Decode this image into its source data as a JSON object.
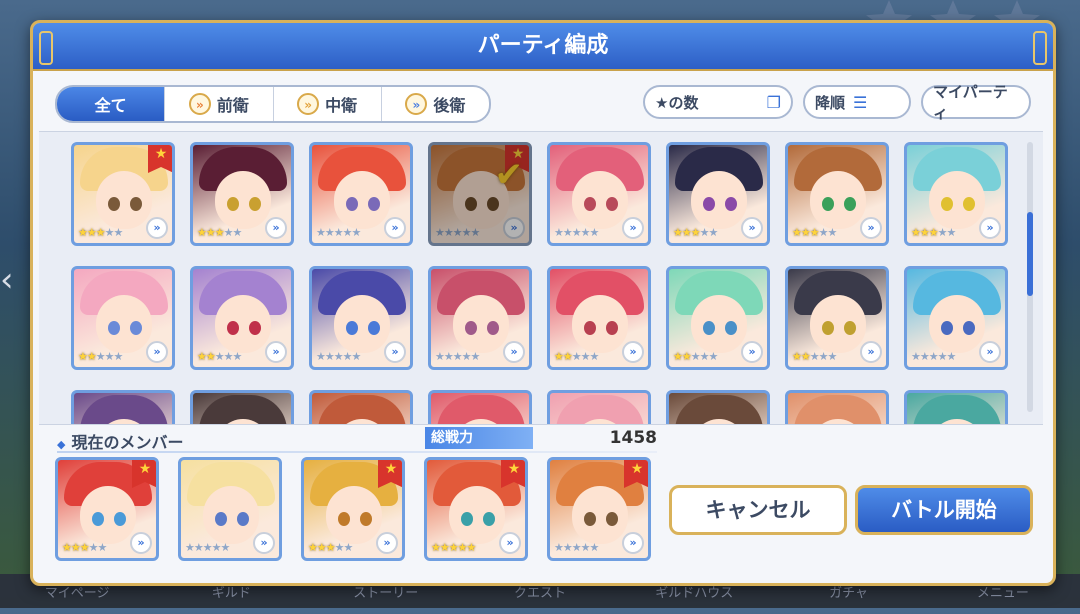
{
  "title": "パーティ編成",
  "filter_tabs": [
    {
      "label": "全て",
      "active": true,
      "icon": ""
    },
    {
      "label": "前衛",
      "active": false,
      "icon": "front-role-icon"
    },
    {
      "label": "中衛",
      "active": false,
      "icon": "middle-role-icon"
    },
    {
      "label": "後衛",
      "active": false,
      "icon": "back-role-icon"
    }
  ],
  "star_filter_label": "★の数",
  "sort_label": "降順",
  "my_party_label": "マイパーティ",
  "roster": [
    {
      "stars": 3,
      "fav": true,
      "selected": false,
      "hair": "#f6d48c",
      "eye": "#7a5a3a"
    },
    {
      "stars": 3,
      "fav": false,
      "selected": false,
      "hair": "#5a1e34",
      "eye": "#c9a030"
    },
    {
      "stars": 0,
      "fav": false,
      "selected": false,
      "hair": "#e8523c",
      "eye": "#7a6ab8"
    },
    {
      "stars": 0,
      "fav": true,
      "selected": true,
      "hair": "#c8763a",
      "eye": "#6a4a2a"
    },
    {
      "stars": 0,
      "fav": false,
      "selected": false,
      "hair": "#e3607a",
      "eye": "#b84a5a"
    },
    {
      "stars": 3,
      "fav": false,
      "selected": false,
      "hair": "#2a2a48",
      "eye": "#8a4aa8"
    },
    {
      "stars": 3,
      "fav": false,
      "selected": false,
      "hair": "#b26a3a",
      "eye": "#3aa05a"
    },
    {
      "stars": 3,
      "fav": false,
      "selected": false,
      "hair": "#7ad0d8",
      "eye": "#e0c030"
    },
    {
      "stars": 2,
      "fav": false,
      "selected": false,
      "hair": "#f4a8c0",
      "eye": "#6a8ad8"
    },
    {
      "stars": 2,
      "fav": false,
      "selected": false,
      "hair": "#a482d0",
      "eye": "#c0304a"
    },
    {
      "stars": 0,
      "fav": false,
      "selected": false,
      "hair": "#4a4aa8",
      "eye": "#4a7ad8"
    },
    {
      "stars": 0,
      "fav": false,
      "selected": false,
      "hair": "#c8506a",
      "eye": "#a05a8a"
    },
    {
      "stars": 2,
      "fav": false,
      "selected": false,
      "hair": "#e25066",
      "eye": "#b84050"
    },
    {
      "stars": 2,
      "fav": false,
      "selected": false,
      "hair": "#7ed8b8",
      "eye": "#4a90c8"
    },
    {
      "stars": 2,
      "fav": false,
      "selected": false,
      "hair": "#3a3a4a",
      "eye": "#c0a030"
    },
    {
      "stars": 0,
      "fav": false,
      "selected": false,
      "hair": "#56b8e0",
      "eye": "#4a6ac0"
    },
    {
      "stars": 0,
      "fav": false,
      "selected": false,
      "hair": "#6a4a8a",
      "eye": "#6a4a8a"
    },
    {
      "stars": 0,
      "fav": false,
      "selected": false,
      "hair": "#4a3a3a",
      "eye": "#4a3a3a"
    },
    {
      "stars": 0,
      "fav": false,
      "selected": false,
      "hair": "#c05a3a",
      "eye": "#c05a3a"
    },
    {
      "stars": 0,
      "fav": false,
      "selected": false,
      "hair": "#e05a6a",
      "eye": "#e05a6a"
    },
    {
      "stars": 0,
      "fav": false,
      "selected": false,
      "hair": "#f0a0b0",
      "eye": "#f0a0b0"
    },
    {
      "stars": 0,
      "fav": false,
      "selected": false,
      "hair": "#6a4a3a",
      "eye": "#6a4a3a"
    },
    {
      "stars": 0,
      "fav": false,
      "selected": false,
      "hair": "#e0906a",
      "eye": "#e0906a"
    },
    {
      "stars": 0,
      "fav": false,
      "selected": false,
      "hair": "#4aa8a0",
      "eye": "#4aa8a0"
    }
  ],
  "members_label": "現在のメンバー",
  "total_power_label": "総戦力",
  "total_power_value": "1458",
  "members": [
    {
      "stars": 3,
      "fav": true,
      "hair": "#e0403a",
      "eye": "#4a9ad8"
    },
    {
      "stars": 0,
      "fav": false,
      "hair": "#f6e0a0",
      "eye": "#5a7ac8"
    },
    {
      "stars": 3,
      "fav": true,
      "hair": "#e6b040",
      "eye": "#c07a2a"
    },
    {
      "stars": 5,
      "fav": true,
      "hair": "#e25a3a",
      "eye": "#3aa0a8"
    },
    {
      "stars": 0,
      "fav": true,
      "hair": "#e08040",
      "eye": "#7a5a3a"
    }
  ],
  "cancel_label": "キャンセル",
  "start_label": "バトル開始",
  "background_nav": [
    "マイページ",
    "ギルド",
    "ストーリー",
    "クエスト",
    "ギルドハウス",
    "ガチャ",
    "メニュー"
  ]
}
